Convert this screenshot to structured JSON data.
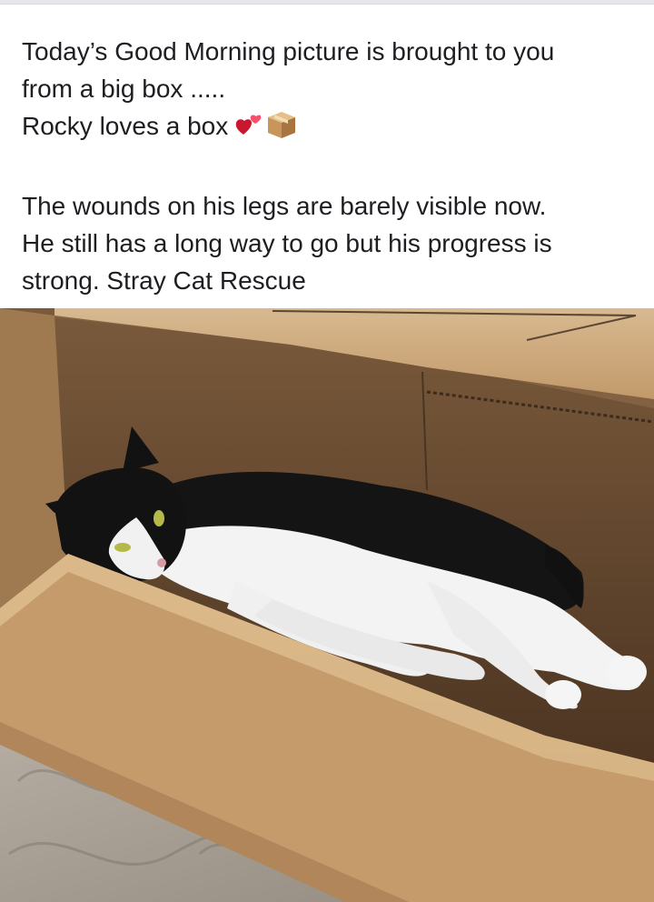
{
  "post": {
    "lines": [
      "Today’s Good Morning picture is brought to you",
      "from a big box .....",
      "Rocky loves a box "
    ],
    "paragraph2_lines": [
      "The wounds on his legs are barely visible now.",
      "He still has a long way to go but his progress is",
      "strong. Stray Cat Rescue"
    ],
    "emojis": [
      "heart-icon",
      "package-icon"
    ]
  },
  "photo": {
    "subject": "black-and-white-cat-in-cardboard-box"
  },
  "colors": {
    "text": "#1c1e21",
    "background": "#ffffff",
    "cardboard": "#c9a57c",
    "heart": "#e0245e"
  }
}
